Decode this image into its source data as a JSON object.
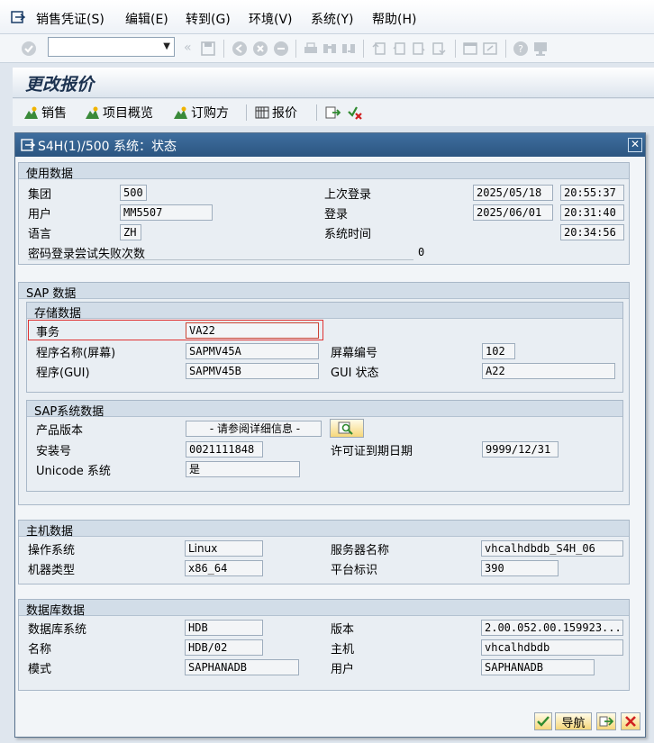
{
  "menu": {
    "items": [
      "销售凭证(S)",
      "编辑(E)",
      "转到(G)",
      "环境(V)",
      "系统(Y)",
      "帮助(H)"
    ]
  },
  "command_field": {
    "value": ""
  },
  "screen_title": "更改报价",
  "app_toolbar": {
    "sales": "销售",
    "item_overview": "项目概览",
    "sold_to_party": "订购方",
    "quotation": "报价"
  },
  "dialog": {
    "title": "S4H(1)/500 系统：状态",
    "usage": {
      "header": "使用数据",
      "client_label": "集团",
      "client_value": "500",
      "user_label": "用户",
      "user_value": "MM5507",
      "language_label": "语言",
      "language_value": "ZH",
      "failed_label": "密码登录尝试失败次数",
      "failed_value": "0",
      "last_logon_label": "上次登录",
      "last_logon_date": "2025/05/18",
      "last_logon_time": "20:55:37",
      "logon_label": "登录",
      "logon_date": "2025/06/01",
      "logon_time": "20:31:40",
      "system_time_label": "系统时间",
      "system_time": "20:34:56"
    },
    "sap": {
      "header": "SAP 数据",
      "repository": {
        "header": "存储数据",
        "transaction_label": "事务",
        "transaction_value": "VA22",
        "program_screen_label": "程序名称(屏幕)",
        "program_screen_value": "SAPMV45A",
        "screen_number_label": "屏幕编号",
        "screen_number_value": "102",
        "program_gui_label": "程序(GUI)",
        "program_gui_value": "SAPMV45B",
        "gui_status_label": "GUI 状态",
        "gui_status_value": "A22"
      },
      "system": {
        "header": "SAP系统数据",
        "product_version_label": "产品版本",
        "product_version_value": "- 请参阅详细信息 -",
        "installation_label": "安装号",
        "installation_value": "0021111848",
        "license_expiry_label": "许可证到期日期",
        "license_expiry_value": "9999/12/31",
        "unicode_label": "Unicode 系统",
        "unicode_value": "是"
      }
    },
    "host": {
      "header": "主机数据",
      "os_label": "操作系统",
      "os_value": "Linux",
      "server_label": "服务器名称",
      "server_value": "vhcalhdbdb_S4H_06",
      "machine_label": "机器类型",
      "machine_value": "x86_64",
      "platform_label": "平台标识",
      "platform_value": "390"
    },
    "database": {
      "header": "数据库数据",
      "system_label": "数据库系统",
      "system_value": "HDB",
      "version_label": "版本",
      "version_value": "2.00.052.00.159923...",
      "name_label": "名称",
      "name_value": "HDB/02",
      "host_label": "主机",
      "host_value": "vhcalhdbdb",
      "schema_label": "模式",
      "schema_value": "SAPHANADB",
      "user_label": "用户",
      "user_value": "SAPHANADB"
    },
    "navigation_button": "导航"
  },
  "colors": {
    "dialog_header": "#2b5580",
    "highlight_border": "#e03333",
    "group_header": "#d2dde8",
    "field_border": "#9eadbd"
  }
}
